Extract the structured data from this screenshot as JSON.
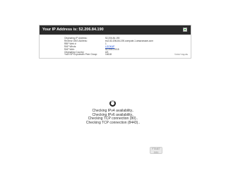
{
  "header": {
    "title": "Your IP Address is: 52.206.84.190"
  },
  "details": [
    {
      "label": "Originating IP Address:",
      "value": "52.206.84.190",
      "link": false
    },
    {
      "label": "Reverse DNS Address:",
      "value": "ec2-52-206-84-190.compute-1.amazonaws.com",
      "link": false
    },
    {
      "label": "RBP Web #:",
      "value": "1",
      "link": false
    },
    {
      "label": "RAP Whois:",
      "value": "LOOKUP",
      "link": true
    },
    {
      "label": "RAP Web:",
      "value": "52.206.0.0/15",
      "link": false
    },
    {
      "label": "Originating Country:",
      "value": "US",
      "link": false
    },
    {
      "label": "Your ISP's upstream Peer Group:",
      "value": "14618",
      "link": false
    }
  ],
  "copyright": "©2017 Digu8s",
  "checks": [
    "Checking IPv4 availability..",
    "Checking IPv6 availability..",
    "Checking TCP connection (80)..",
    "Checking TCP connection (8443).."
  ],
  "badge": {
    "line1": "FTINET",
    "line2": "1111"
  }
}
